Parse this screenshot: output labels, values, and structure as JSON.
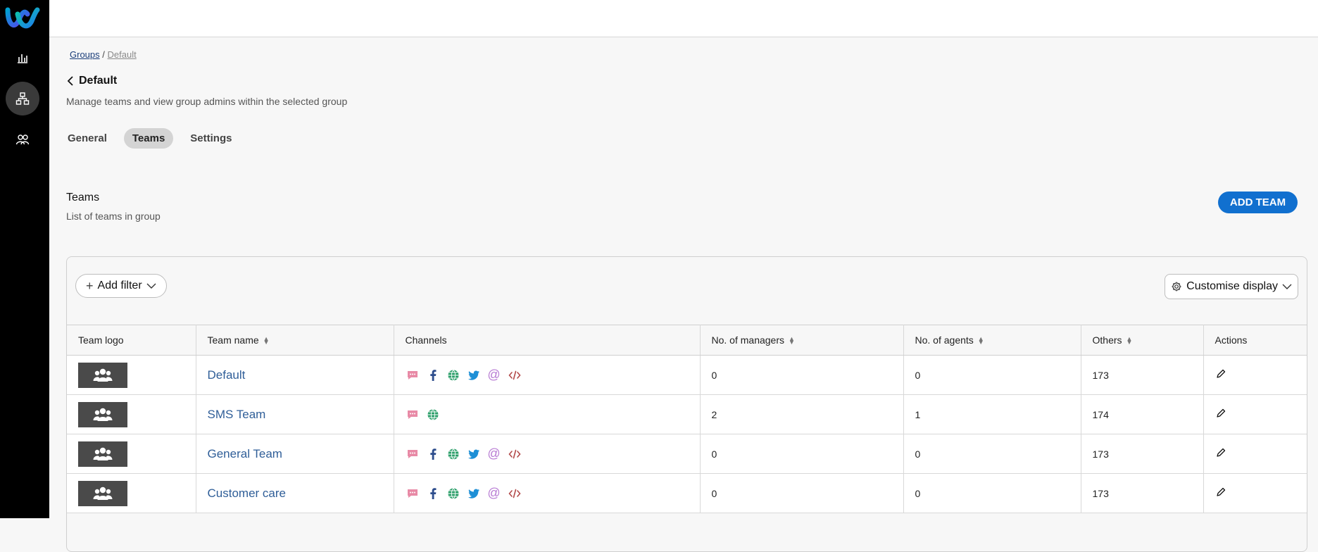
{
  "breadcrumb": {
    "root": "Groups",
    "separator": "/",
    "current": "Default"
  },
  "page": {
    "title": "Default",
    "subtitle": "Manage teams and view group admins within the selected group"
  },
  "tabs": [
    {
      "label": "General",
      "active": false
    },
    {
      "label": "Teams",
      "active": true
    },
    {
      "label": "Settings",
      "active": false
    }
  ],
  "section": {
    "title": "Teams",
    "subtitle": "List of teams in group",
    "add_button": "ADD TEAM"
  },
  "toolbar": {
    "filter_label": "Add filter",
    "customise_label": "Customise display"
  },
  "table": {
    "headers": {
      "logo": "Team logo",
      "name": "Team name",
      "channels": "Channels",
      "managers": "No. of managers",
      "agents": "No. of agents",
      "others": "Others",
      "actions": "Actions"
    },
    "rows": [
      {
        "name": "Default",
        "channels": [
          "sms-icon",
          "facebook-icon",
          "web-icon",
          "twitter-icon",
          "email-icon",
          "code-icon"
        ],
        "managers": "0",
        "agents": "0",
        "others": "173"
      },
      {
        "name": "SMS Team",
        "channels": [
          "sms-icon",
          "web-icon"
        ],
        "managers": "2",
        "agents": "1",
        "others": "174"
      },
      {
        "name": "General Team",
        "channels": [
          "sms-icon",
          "facebook-icon",
          "web-icon",
          "twitter-icon",
          "email-icon",
          "code-icon"
        ],
        "managers": "0",
        "agents": "0",
        "others": "173"
      },
      {
        "name": "Customer care",
        "channels": [
          "sms-icon",
          "facebook-icon",
          "web-icon",
          "twitter-icon",
          "email-icon",
          "code-icon"
        ],
        "managers": "0",
        "agents": "0",
        "others": "173"
      }
    ]
  },
  "colors": {
    "accent": "#1170cf",
    "link": "#2f5e98",
    "sidebar": "#000000",
    "sms": "#e88aa6",
    "facebook": "#2d4d8c",
    "web": "#2c9f6a",
    "twitter": "#1d8fd6",
    "email": "#b77ad3",
    "code": "#b34a4a"
  }
}
